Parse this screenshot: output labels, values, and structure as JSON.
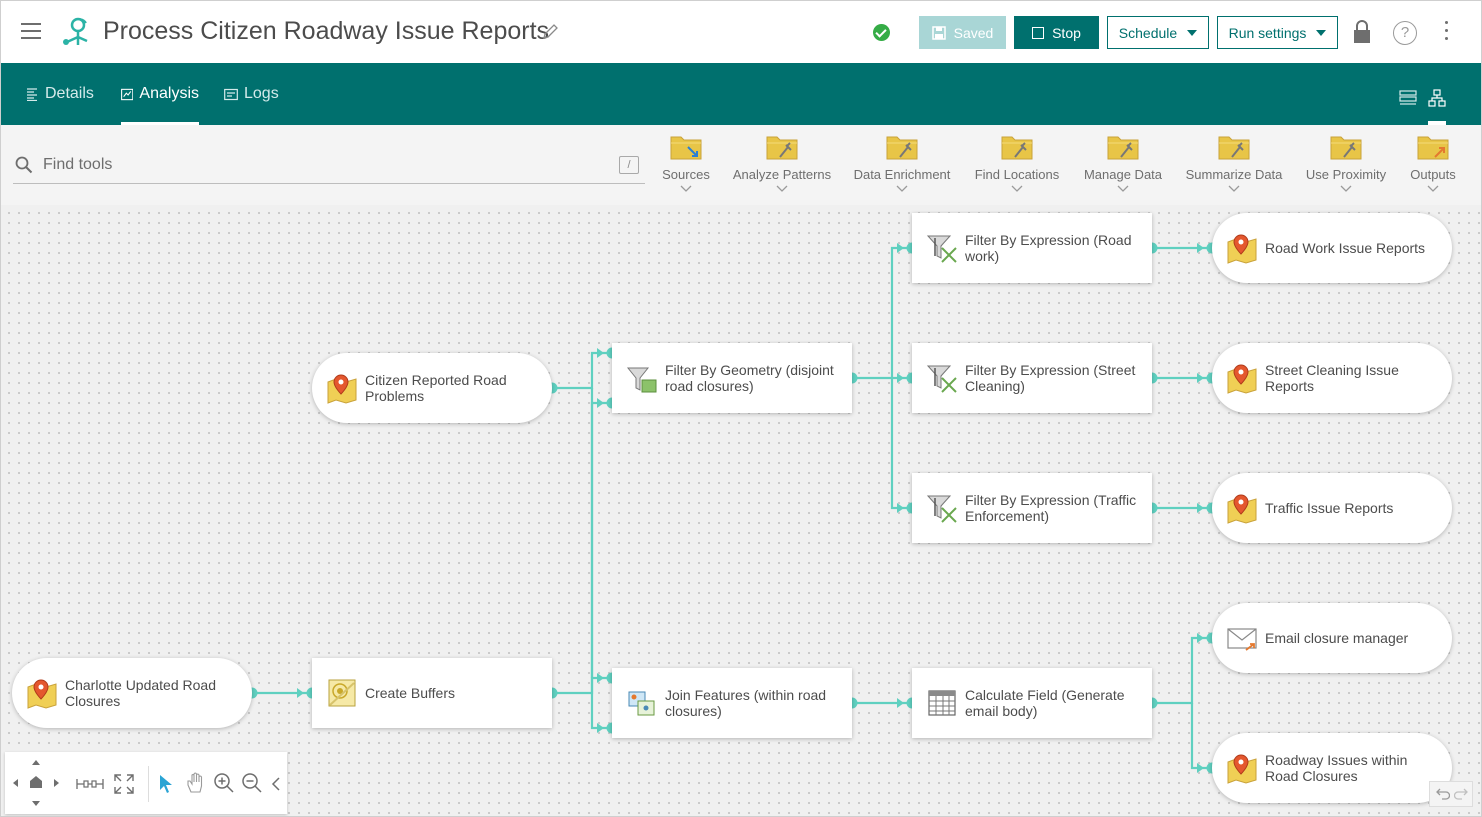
{
  "header": {
    "title": "Process Citizen Roadway Issue Reports",
    "saved_label": "Saved",
    "stop_label": "Stop",
    "schedule_label": "Schedule",
    "run_settings_label": "Run settings",
    "help_label": "?"
  },
  "nav": {
    "tabs": [
      {
        "label": "Details"
      },
      {
        "label": "Analysis"
      },
      {
        "label": "Logs"
      }
    ],
    "active_tab": "Analysis"
  },
  "toolbar": {
    "search_placeholder": "Find tools",
    "shortcut": "/",
    "categories": [
      {
        "label": "Sources",
        "icon": "folder-import-icon"
      },
      {
        "label": "Analyze Patterns",
        "icon": "folder-tools-icon"
      },
      {
        "label": "Data Enrichment",
        "icon": "folder-tools-icon"
      },
      {
        "label": "Find Locations",
        "icon": "folder-tools-icon"
      },
      {
        "label": "Manage Data",
        "icon": "folder-tools-icon"
      },
      {
        "label": "Summarize Data",
        "icon": "folder-tools-icon"
      },
      {
        "label": "Use Proximity",
        "icon": "folder-tools-icon"
      },
      {
        "label": "Outputs",
        "icon": "folder-export-icon"
      }
    ]
  },
  "nodes": {
    "charlotte_closures": "Charlotte Updated Road Closures",
    "citizen_problems": "Citizen Reported Road Problems",
    "create_buffers": "Create Buffers",
    "filter_geometry": "Filter By Geometry (disjoint road closures)",
    "join_features": "Join Features (within road closures)",
    "filter_roadwork": "Filter By Expression (Road work)",
    "filter_cleaning": "Filter By Expression (Street Cleaning)",
    "filter_traffic": "Filter By Expression (Traffic Enforcement)",
    "calculate_field": "Calculate Field (Generate email body)",
    "out_roadwork": "Road Work Issue Reports",
    "out_cleaning": "Street Cleaning Issue Reports",
    "out_traffic": "Traffic Issue Reports",
    "out_email": "Email closure manager",
    "out_issues_closures": "Roadway Issues within Road Closures"
  },
  "colors": {
    "brand": "#00706e",
    "connector": "#5fd0c0",
    "status_ok": "#35ac46",
    "folder": "#e8c547"
  }
}
